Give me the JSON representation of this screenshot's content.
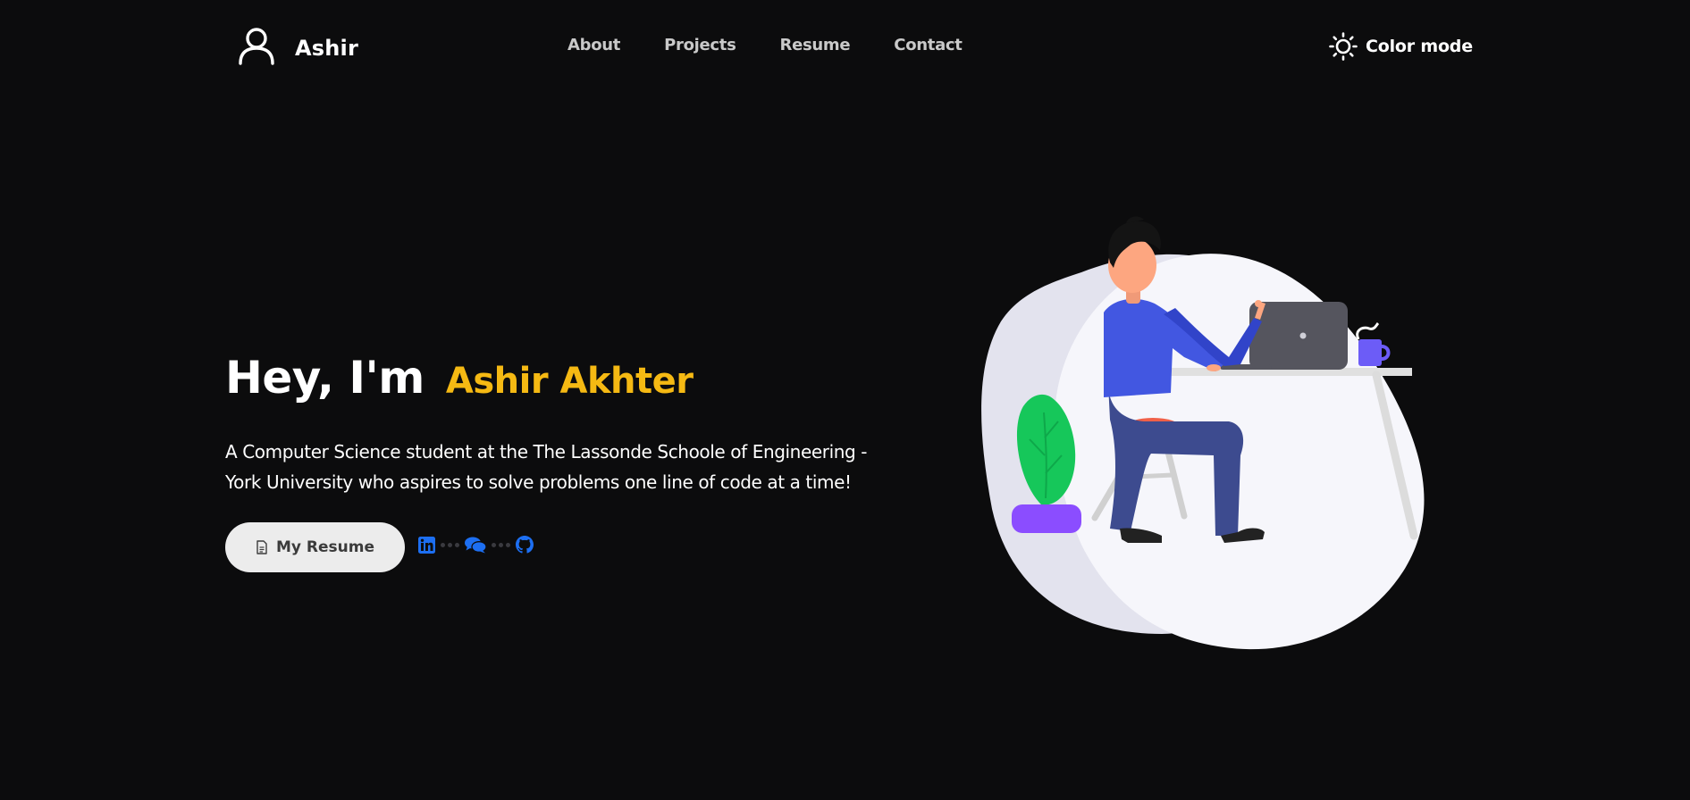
{
  "header": {
    "brand": {
      "icon": "user-icon",
      "name": "Ashir"
    },
    "nav": [
      {
        "label": "About"
      },
      {
        "label": "Projects"
      },
      {
        "label": "Resume"
      },
      {
        "label": "Contact"
      }
    ],
    "color_mode": {
      "icon": "sun-icon",
      "label": "Color mode"
    }
  },
  "hero": {
    "greeting": "Hey, I'm",
    "name": "Ashir Akhter",
    "description": "A Computer Science student at the The Lassonde Schoole of Engineering - York University who aspires to solve problems one line of code at a time!",
    "resume_button": {
      "icon": "document-icon",
      "label": "My Resume"
    },
    "socials": [
      {
        "icon": "linkedin-icon"
      },
      {
        "icon": "chat-icon"
      },
      {
        "icon": "github-icon"
      }
    ]
  },
  "illustration": {
    "subject": "person-working-at-laptop-illustration"
  },
  "colors": {
    "background": "#0c0c0d",
    "accent": "#f5b913",
    "link_blue": "#1d6ff2",
    "nav_text": "#c9c9c9",
    "button_bg": "#ececec"
  }
}
